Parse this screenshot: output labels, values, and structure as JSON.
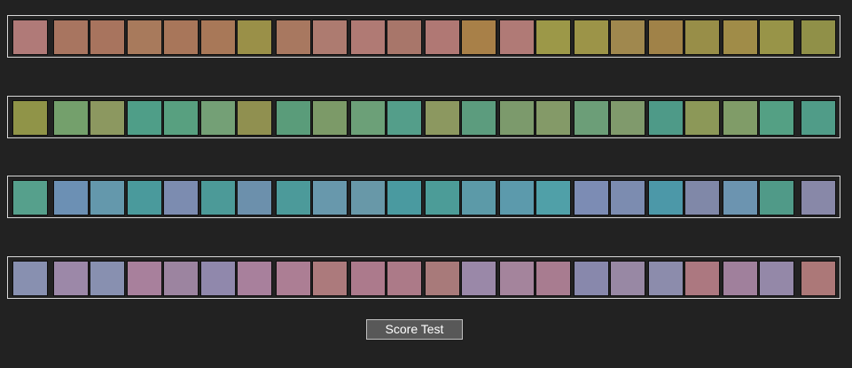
{
  "score_button": {
    "label": "Score Test"
  },
  "rows": [
    {
      "name": "row-1",
      "chips": [
        "#b07a78",
        "#a87560",
        "#a8745e",
        "#a87a5c",
        "#a8765a",
        "#a87858",
        "#9a9048",
        "#a87860",
        "#ad7b70",
        "#b07a74",
        "#a8766a",
        "#b07874",
        "#a88048",
        "#b07a76",
        "#9c9848",
        "#9c9448",
        "#a0884e",
        "#a08248",
        "#988e48",
        "#a08c48",
        "#989448",
        "#909048"
      ]
    },
    {
      "name": "row-2",
      "chips": [
        "#909448",
        "#74a06c",
        "#8c9860",
        "#4f9e88",
        "#58a080",
        "#74a076",
        "#909050",
        "#5a9c7a",
        "#7c9a68",
        "#6ca078",
        "#549e8a",
        "#8c9860",
        "#5c9c7e",
        "#7c9a6c",
        "#849a68",
        "#6c9e78",
        "#809a6c",
        "#4e9a88",
        "#8c9858",
        "#809c68",
        "#54a084",
        "#509c88"
      ]
    },
    {
      "name": "row-3",
      "chips": [
        "#56a08c",
        "#6c90b4",
        "#6498ac",
        "#4a9a9c",
        "#7c8cb0",
        "#4c9a98",
        "#6c90ac",
        "#4c9a9a",
        "#6898ac",
        "#6898a8",
        "#4a9aa0",
        "#4c9c98",
        "#5c9aa8",
        "#5c9aac",
        "#50a0a8",
        "#7c8cb4",
        "#7c8cb0",
        "#4c98a8",
        "#8088a8",
        "#6c94b0",
        "#509a88",
        "#8888a8"
      ]
    },
    {
      "name": "row-4",
      "chips": [
        "#8890b0",
        "#9c88a8",
        "#8890b0",
        "#a8809c",
        "#9c84a0",
        "#9088ac",
        "#a8809c",
        "#ac7e94",
        "#ac7a7c",
        "#ac7a8c",
        "#ac7a88",
        "#a87a7a",
        "#9a88a8",
        "#a4849c",
        "#a87c90",
        "#8888ac",
        "#9888a4",
        "#8c8cac",
        "#ac7880",
        "#a0809c",
        "#9488a8",
        "#ac7878"
      ]
    }
  ]
}
